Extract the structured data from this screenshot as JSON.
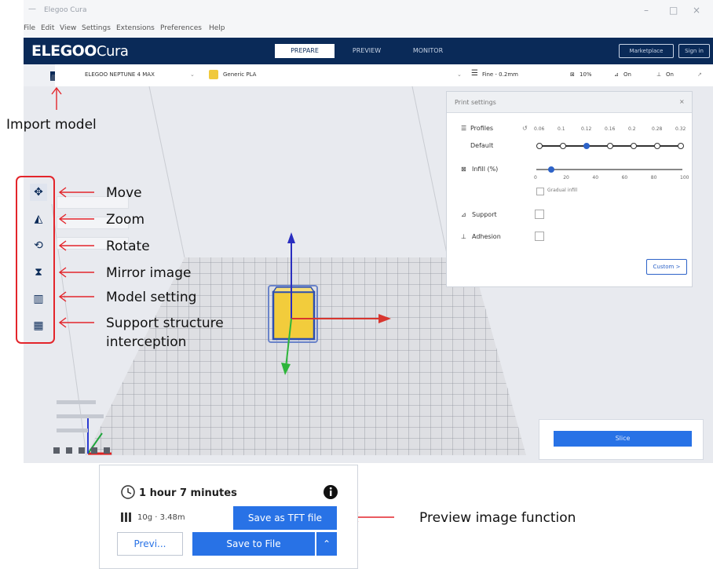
{
  "window": {
    "title": "Elegoo Cura",
    "controls": [
      "–",
      "□",
      "×"
    ]
  },
  "menu": [
    "File",
    "Edit",
    "View",
    "Settings",
    "Extensions",
    "Preferences",
    "Help"
  ],
  "header": {
    "logo_main": "ELEGOO",
    "logo_sub": "Cura",
    "tabs": [
      {
        "label": "PREPARE",
        "active": true
      },
      {
        "label": "PREVIEW",
        "active": false
      },
      {
        "label": "MONITOR",
        "active": false
      }
    ],
    "marketplace_label": "Marketplace",
    "signin_label": "Sign in"
  },
  "stage_bar": {
    "printer": "ELEGOO NEPTUNE 4 MAX",
    "material": "Generic PLA",
    "profile": "Fine - 0.2mm",
    "infill": "10%",
    "support": "On",
    "adhesion": "On"
  },
  "print_settings": {
    "title": "Print settings",
    "profiles_label": "Profiles",
    "default_label": "Default",
    "layer_values": [
      "0.06",
      "0.1",
      "0.12",
      "0.16",
      "0.2",
      "0.28",
      "0.32"
    ],
    "selected_layer_index": 2,
    "infill_label": "Infill (%)",
    "infill_ticks": [
      "0",
      "20",
      "40",
      "60",
      "80",
      "100"
    ],
    "infill_value": 10,
    "gradual_label": "Gradual infill",
    "support_label": "Support",
    "adhesion_label": "Adhesion",
    "custom_label": "Custom >"
  },
  "slice_label": "Slice",
  "annotations": {
    "import_model": "Import model",
    "move": "Move",
    "zoom": "Zoom",
    "rotate": "Rotate",
    "mirror": "Mirror image",
    "model_setting": "Model setting",
    "support_line1": "Support structure",
    "support_line2": "interception",
    "preview": "Preview image function"
  },
  "popup": {
    "time": "1 hour 7 minutes",
    "material": "10g · 3.48m",
    "save_tft": "Save as TFT file",
    "preview_btn": "Previ...",
    "save_file": "Save to File"
  },
  "colors": {
    "header": "#0a2a58",
    "accent": "#2872e6",
    "callout": "#e3252b",
    "model": "#f0c93c"
  }
}
